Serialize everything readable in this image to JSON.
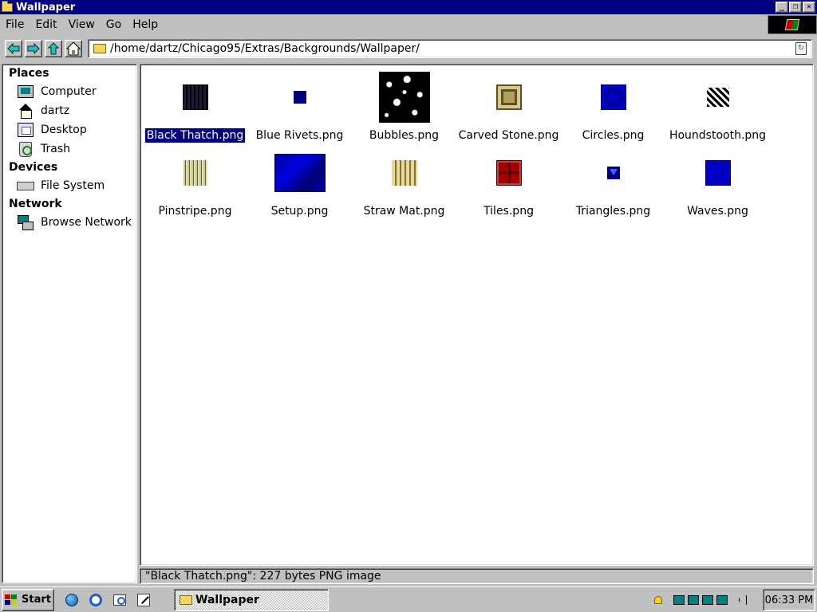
{
  "window": {
    "title": "Wallpaper",
    "controls": {
      "minimize": "_",
      "maximize": "❐",
      "close": "✕"
    }
  },
  "menubar": {
    "items": [
      "File",
      "Edit",
      "View",
      "Go",
      "Help"
    ]
  },
  "toolbar": {
    "back_icon": "back-arrow-icon",
    "forward_icon": "forward-arrow-icon",
    "up_icon": "up-arrow-icon",
    "home_icon": "home-icon",
    "address": "/home/dartz/Chicago95/Extras/Backgrounds/Wallpaper/"
  },
  "sidebar": {
    "sections": [
      {
        "title": "Places",
        "items": [
          {
            "label": "Computer",
            "icon": "computer-icon"
          },
          {
            "label": "dartz",
            "icon": "home-folder-icon"
          },
          {
            "label": "Desktop",
            "icon": "desktop-icon"
          },
          {
            "label": "Trash",
            "icon": "trash-icon"
          }
        ]
      },
      {
        "title": "Devices",
        "items": [
          {
            "label": "File System",
            "icon": "drive-icon"
          }
        ]
      },
      {
        "title": "Network",
        "items": [
          {
            "label": "Browse Network",
            "icon": "network-icon"
          }
        ]
      }
    ]
  },
  "files": [
    {
      "name": "Black Thatch.png",
      "thumb": "black-thatch",
      "selected": true
    },
    {
      "name": "Blue Rivets.png",
      "thumb": "blue-rivets",
      "selected": false
    },
    {
      "name": "Bubbles.png",
      "thumb": "bubbles",
      "selected": false
    },
    {
      "name": "Carved Stone.png",
      "thumb": "carved-stone",
      "selected": false
    },
    {
      "name": "Circles.png",
      "thumb": "circles",
      "selected": false
    },
    {
      "name": "Houndstooth.png",
      "thumb": "houndstooth",
      "selected": false
    },
    {
      "name": "Pinstripe.png",
      "thumb": "pinstripe",
      "selected": false
    },
    {
      "name": "Setup.png",
      "thumb": "setup",
      "selected": false
    },
    {
      "name": "Straw Mat.png",
      "thumb": "straw-mat",
      "selected": false
    },
    {
      "name": "Tiles.png",
      "thumb": "tiles",
      "selected": false
    },
    {
      "name": "Triangles.png",
      "thumb": "triangles",
      "selected": false
    },
    {
      "name": "Waves.png",
      "thumb": "waves",
      "selected": false
    }
  ],
  "statusbar": {
    "text": "\"Black Thatch.png\": 227 bytes PNG image"
  },
  "taskbar": {
    "start_label": "Start",
    "quick_launch": [
      "globe-icon",
      "browser-icon",
      "search-icon",
      "editor-icon"
    ],
    "tasks": [
      {
        "label": "Wallpaper",
        "active": true
      }
    ],
    "tray": [
      "notification-bell-icon",
      "network-icon",
      "network-icon",
      "network-icon",
      "network-icon",
      "volume-icon"
    ],
    "clock": "06:33 PM"
  },
  "colors": {
    "titlebar": "#000080",
    "selection": "#000080",
    "face": "#c0c0c0",
    "window_bg": "#ffffff"
  }
}
